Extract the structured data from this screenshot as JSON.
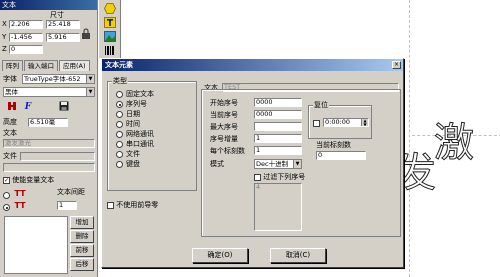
{
  "left_panel": {
    "title": "文本",
    "x_label": "X",
    "y_label": "Y",
    "z_label": "Z",
    "pos_x": "2.206",
    "pos_y": "-1.456",
    "pos_z": "0",
    "size_header": "尺寸",
    "size_w": "25.418",
    "size_h": "5.916",
    "tabs": [
      "阵列",
      "输入端口",
      "应用(A)"
    ],
    "font_label": "字体",
    "font_type": "TrueType字体-652",
    "font_name": "黑体",
    "height_label": "高度",
    "height_value": "6.510毫",
    "text_label": "文本",
    "text_value": "激发激光",
    "file_label": "文件",
    "variable_label": "使能变量文本",
    "spacing_label": "文本间距",
    "spacing_value": "1",
    "buttons": [
      "增加",
      "删除",
      "前移",
      "后移"
    ]
  },
  "dialog": {
    "title": "文本元素",
    "close_glyph": "×",
    "type_group_label": "类型",
    "types": [
      "固定文本",
      "序列号",
      "日期",
      "时间",
      "网络通讯",
      "串口通讯",
      "文件",
      "键盘"
    ],
    "selected_type_index": 1,
    "text_label": "文本",
    "text_value": "TEST",
    "fields": {
      "start_label": "开始序号",
      "start_value": "0000",
      "current_label": "当前序号",
      "current_value": "0000",
      "max_label": "最大序号",
      "max_value": "",
      "increment_label": "序号增量",
      "increment_value": "1",
      "per_mark_label": "每个标刻数",
      "per_mark_value": "1",
      "mode_label": "模式",
      "mode_value": "Dec十进制"
    },
    "reset_group_label": "复位",
    "reset_time": "0:00:00",
    "current_mark_label": "当前标刻数",
    "current_mark_value": "0",
    "filter_label": "过滤下列序号",
    "filter_list_value": "4",
    "no_leading_zero_label": "不使用前导零",
    "ok_label": "确定(O)",
    "cancel_label": "取消(C)"
  },
  "canvas": {
    "big_text_char": "激",
    "big_text_char2": "发"
  },
  "icons": {
    "lock": "padlock-icon",
    "bold_toggle": "bold-icon",
    "italic_font": "font-f-icon",
    "save": "save-icon"
  }
}
